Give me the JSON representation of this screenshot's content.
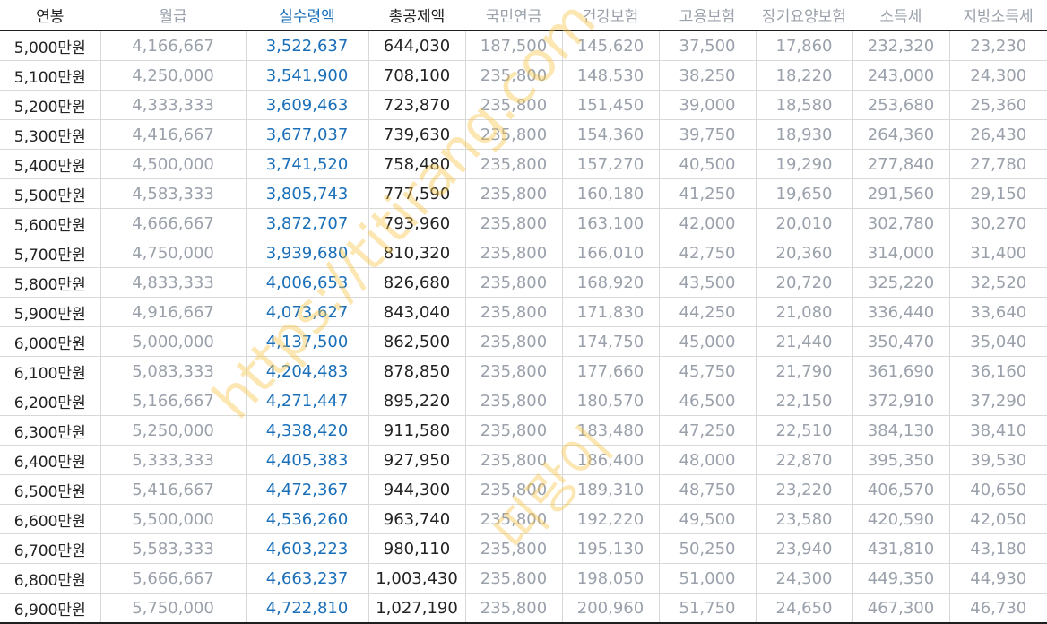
{
  "headers": [
    "연봉",
    "월급",
    "실수령액",
    "총공제액",
    "국민연금",
    "건강보험",
    "고용보험",
    "장기요양보험",
    "소득세",
    "지방소득세"
  ],
  "rows": [
    [
      "5,000만원",
      "4,166,667",
      "3,522,637",
      "644,030",
      "187,500",
      "145,620",
      "37,500",
      "17,860",
      "232,320",
      "23,230"
    ],
    [
      "5,100만원",
      "4,250,000",
      "3,541,900",
      "708,100",
      "235,800",
      "148,530",
      "38,250",
      "18,220",
      "243,000",
      "24,300"
    ],
    [
      "5,200만원",
      "4,333,333",
      "3,609,463",
      "723,870",
      "235,800",
      "151,450",
      "39,000",
      "18,580",
      "253,680",
      "25,360"
    ],
    [
      "5,300만원",
      "4,416,667",
      "3,677,037",
      "739,630",
      "235,800",
      "154,360",
      "39,750",
      "18,930",
      "264,360",
      "26,430"
    ],
    [
      "5,400만원",
      "4,500,000",
      "3,741,520",
      "758,480",
      "235,800",
      "157,270",
      "40,500",
      "19,290",
      "277,840",
      "27,780"
    ],
    [
      "5,500만원",
      "4,583,333",
      "3,805,743",
      "777,590",
      "235,800",
      "160,180",
      "41,250",
      "19,650",
      "291,560",
      "29,150"
    ],
    [
      "5,600만원",
      "4,666,667",
      "3,872,707",
      "793,960",
      "235,800",
      "163,100",
      "42,000",
      "20,010",
      "302,780",
      "30,270"
    ],
    [
      "5,700만원",
      "4,750,000",
      "3,939,680",
      "810,320",
      "235,800",
      "166,010",
      "42,750",
      "20,360",
      "314,000",
      "31,400"
    ],
    [
      "5,800만원",
      "4,833,333",
      "4,006,653",
      "826,680",
      "235,800",
      "168,920",
      "43,500",
      "20,720",
      "325,220",
      "32,520"
    ],
    [
      "5,900만원",
      "4,916,667",
      "4,073,627",
      "843,040",
      "235,800",
      "171,830",
      "44,250",
      "21,080",
      "336,440",
      "33,640"
    ],
    [
      "6,000만원",
      "5,000,000",
      "4,137,500",
      "862,500",
      "235,800",
      "174,750",
      "45,000",
      "21,440",
      "350,470",
      "35,040"
    ],
    [
      "6,100만원",
      "5,083,333",
      "4,204,483",
      "878,850",
      "235,800",
      "177,660",
      "45,750",
      "21,790",
      "361,690",
      "36,160"
    ],
    [
      "6,200만원",
      "5,166,667",
      "4,271,447",
      "895,220",
      "235,800",
      "180,570",
      "46,500",
      "22,150",
      "372,910",
      "37,290"
    ],
    [
      "6,300만원",
      "5,250,000",
      "4,338,420",
      "911,580",
      "235,800",
      "183,480",
      "47,250",
      "22,510",
      "384,130",
      "38,410"
    ],
    [
      "6,400만원",
      "5,333,333",
      "4,405,383",
      "927,950",
      "235,800",
      "186,400",
      "48,000",
      "22,870",
      "395,350",
      "39,530"
    ],
    [
      "6,500만원",
      "5,416,667",
      "4,472,367",
      "944,300",
      "235,800",
      "189,310",
      "48,750",
      "23,220",
      "406,570",
      "40,650"
    ],
    [
      "6,600만원",
      "5,500,000",
      "4,536,260",
      "963,740",
      "235,800",
      "192,220",
      "49,500",
      "23,580",
      "420,590",
      "42,050"
    ],
    [
      "6,700만원",
      "5,583,333",
      "4,603,223",
      "980,110",
      "235,800",
      "195,130",
      "50,250",
      "23,940",
      "431,810",
      "43,180"
    ],
    [
      "6,800만원",
      "5,666,667",
      "4,663,237",
      "1,003,430",
      "235,800",
      "198,050",
      "51,000",
      "24,300",
      "449,350",
      "44,930"
    ],
    [
      "6,900만원",
      "5,750,000",
      "4,722,810",
      "1,027,190",
      "235,800",
      "200,960",
      "51,750",
      "24,650",
      "467,300",
      "46,730"
    ]
  ],
  "watermark": {
    "url": "https://titirang.com",
    "name": "띠랑이"
  },
  "colors": {
    "highlight_blue": "#1a6fb8",
    "muted_gray": "#9aa1ab",
    "dark_text": "#222222",
    "watermark_orange": "#f7c446"
  }
}
